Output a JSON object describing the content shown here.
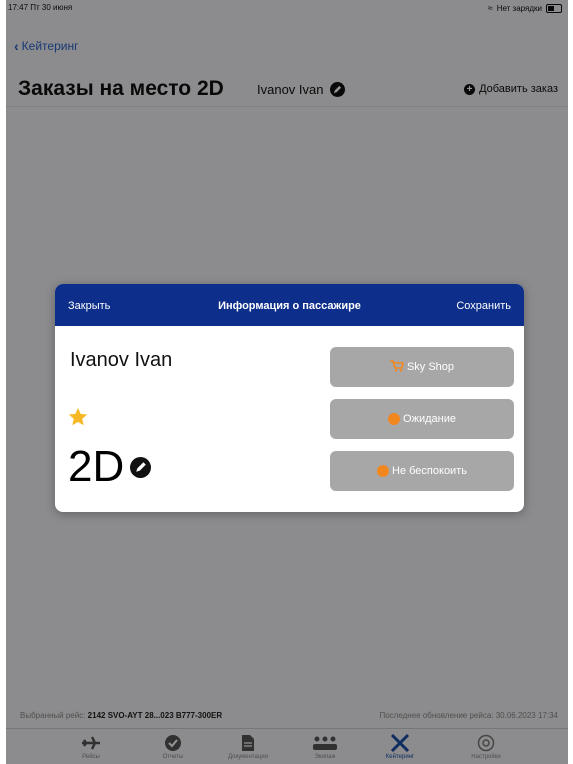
{
  "status_bar": {
    "time_date": "17:47  Пт 30 июня",
    "charging": "Нет зарядки"
  },
  "nav": {
    "back_label": "Кейтеринг"
  },
  "header": {
    "title": "Заказы на место 2D",
    "passenger": "Ivanov Ivan",
    "add_label": "Добавить заказ"
  },
  "footer": {
    "flight_prefix": "Выбранный рейс:",
    "flight_value": "2142 SVO-AYT 28...023 B777-300ER",
    "update_text": "Последнее обновление рейса: 30.06.2023 17:34"
  },
  "tabs": [
    {
      "label": "Рейсы",
      "icon": "plane-icon"
    },
    {
      "label": "Отчеты",
      "icon": "check-icon"
    },
    {
      "label": "Документация",
      "icon": "document-icon"
    },
    {
      "label": "Экипаж",
      "icon": "crew-icon"
    },
    {
      "label": "Кейтеринг",
      "icon": "utensils-icon",
      "active": true
    },
    {
      "label": "Настройки",
      "icon": "settings-icon"
    }
  ],
  "modal": {
    "close_label": "Закрыть",
    "title": "Информация о пассажире",
    "save_label": "Сохранить",
    "passenger_name": "Ivanov Ivan",
    "seat": "2D",
    "buttons": [
      {
        "label": "Sky Shop",
        "icon": "cart-icon"
      },
      {
        "label": "Ожидание",
        "icon": "orange-dot-icon"
      },
      {
        "label": "Не беспокоить",
        "icon": "orange-dot-icon"
      }
    ]
  },
  "colors": {
    "modal_header": "#0d2f8b",
    "accent_orange": "#f2871f",
    "star": "#f6b824",
    "link_blue": "#2a62c9"
  }
}
